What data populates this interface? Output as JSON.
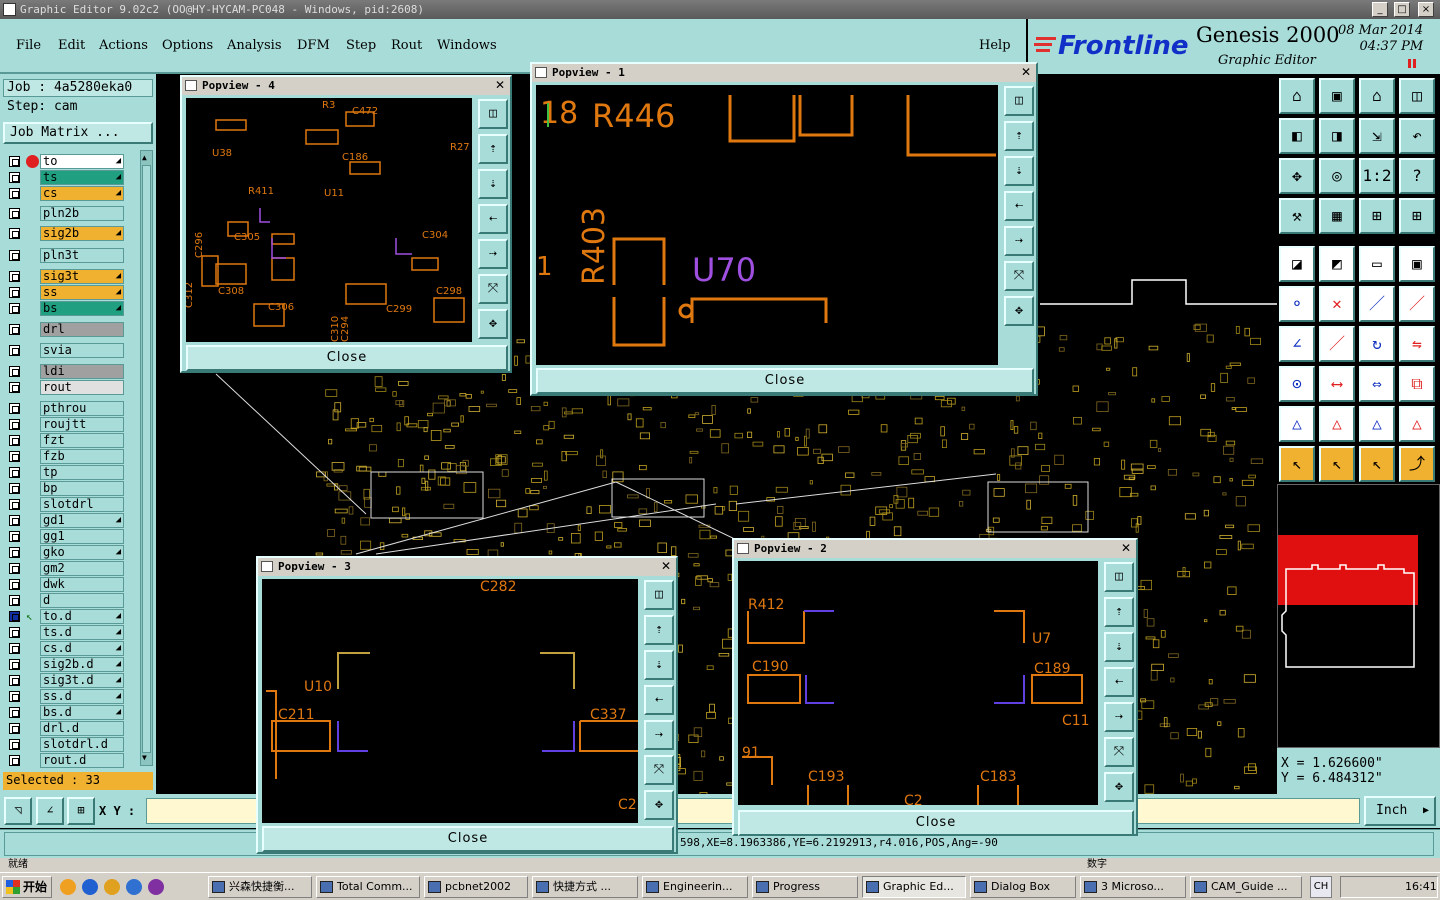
{
  "window": {
    "title": "Graphic Editor 9.02c2 (OO@HY-HYCAM-PC048 - Windows, pid:2608)"
  },
  "menu": [
    "File",
    "Edit",
    "Actions",
    "Options",
    "Analysis",
    "DFM",
    "Step",
    "Rout",
    "Windows"
  ],
  "help": "Help",
  "brand": {
    "logo": "Frontline",
    "product": "Genesis 2000",
    "subtitle": "Graphic Editor",
    "date": "08 Mar 2014",
    "time": "04:37 PM"
  },
  "job": {
    "job_label": "Job : 4a5280eka0",
    "step_label": "Step: cam",
    "matrix_button": "Job Matrix ..."
  },
  "layers": [
    {
      "name": "to",
      "color": "#ffffff",
      "dot": "#e02020"
    },
    {
      "name": "ts",
      "color": "#20a080"
    },
    {
      "name": "cs",
      "color": "#f0b030"
    },
    {
      "name": "pln2b",
      "color": "#a8dcd8"
    },
    {
      "name": "sig2b",
      "color": "#f0b030"
    },
    {
      "name": "pln3t",
      "color": "#a8dcd8"
    },
    {
      "name": "sig3t",
      "color": "#f0b030"
    },
    {
      "name": "ss",
      "color": "#f0b030"
    },
    {
      "name": "bs",
      "color": "#20a080"
    },
    {
      "name": "drl",
      "color": "#a0a0a0"
    },
    {
      "name": "svia",
      "color": "#a8dcd8"
    },
    {
      "name": "ldi",
      "color": "#a0a0a0"
    },
    {
      "name": "rout",
      "color": "#e0e0e0"
    },
    {
      "name": "pthrou",
      "color": "#a8dcd8"
    },
    {
      "name": "roujtt",
      "color": "#a8dcd8"
    },
    {
      "name": "fzt",
      "color": "#a8dcd8"
    },
    {
      "name": "fzb",
      "color": "#a8dcd8"
    },
    {
      "name": "tp",
      "color": "#a8dcd8"
    },
    {
      "name": "bp",
      "color": "#a8dcd8"
    },
    {
      "name": "slotdrl",
      "color": "#a8dcd8"
    },
    {
      "name": "gd1",
      "color": "#a8dcd8"
    },
    {
      "name": "gg1",
      "color": "#a8dcd8"
    },
    {
      "name": "gko",
      "color": "#a8dcd8"
    },
    {
      "name": "gm2",
      "color": "#a8dcd8"
    },
    {
      "name": "dwk",
      "color": "#a8dcd8"
    },
    {
      "name": "d",
      "color": "#a8dcd8"
    },
    {
      "name": "to.d",
      "color": "#a8dcd8"
    },
    {
      "name": "ts.d",
      "color": "#a8dcd8"
    },
    {
      "name": "cs.d",
      "color": "#a8dcd8"
    },
    {
      "name": "sig2b.d",
      "color": "#a8dcd8"
    },
    {
      "name": "sig3t.d",
      "color": "#a8dcd8"
    },
    {
      "name": "ss.d",
      "color": "#a8dcd8"
    },
    {
      "name": "bs.d",
      "color": "#a8dcd8"
    },
    {
      "name": "drl.d",
      "color": "#a8dcd8"
    },
    {
      "name": "slotdrl.d",
      "color": "#a8dcd8"
    },
    {
      "name": "rout.d",
      "color": "#a8dcd8"
    }
  ],
  "selected": "Selected : 33",
  "xy_label": "X Y :",
  "units": "Inch",
  "status_line": "598,XE=8.1963386,YE=6.2192913,r4.016,POS,Ang=-90",
  "status_left": "就绪",
  "status_right": "数字",
  "coords": {
    "x": "X  =  1.626600\"",
    "y": "Y  =  6.484312\""
  },
  "popviews": [
    {
      "title": "Popview - 4",
      "close": "Close",
      "labels": [
        "R3",
        "C472",
        "U38",
        "C186",
        "R27",
        "R411",
        "U11",
        "C305",
        "C304",
        "C296",
        "C312",
        "C308",
        "C306",
        "C310",
        "C294",
        "C299",
        "C298"
      ]
    },
    {
      "title": "Popview - 1",
      "close": "Close",
      "labels": [
        "18",
        "R446",
        "R403",
        "U70",
        "1"
      ]
    },
    {
      "title": "Popview - 3",
      "close": "Close",
      "labels": [
        "C282",
        "U10",
        "C211",
        "C337",
        "C2"
      ]
    },
    {
      "title": "Popview - 2",
      "close": "Close",
      "labels": [
        "R412",
        "U7",
        "C190",
        "C189",
        "C11",
        "91",
        "C193",
        "C183",
        "C2"
      ]
    }
  ],
  "taskbar": {
    "start": "开始",
    "items": [
      "兴森快捷衡...",
      "Total Comm...",
      "pcbnet2002",
      "快捷方式 ...",
      "Engineerin...",
      "Progress",
      "Graphic Ed...",
      "Dialog Box",
      "3 Microso...",
      "CAM_Guide ..."
    ],
    "lang": "CH",
    "clock": "16:41"
  },
  "tool_icons": [
    "home-icon",
    "save-icon",
    "house-icon",
    "window-icon",
    "zoom-in-icon",
    "zoom-out-icon",
    "zoom-fit-icon",
    "undo-icon",
    "pan-icon",
    "center-icon",
    "ratio-icon",
    "help-icon",
    "ruler-icon",
    "grid-icon",
    "snap-icon",
    "snap2-icon",
    "pad-icon",
    "draw-icon",
    "measure-icon",
    "select-icon",
    "connect-icon",
    "cross-icon",
    "line-icon",
    "arrow-icon",
    "angle-icon",
    "slash-icon",
    "rotate-icon",
    "mirror-icon",
    "move-icon",
    "dash-icon",
    "stretch-icon",
    "copy-icon",
    "tri-icon",
    "tri2-icon",
    "tri3-icon",
    "tri4-icon",
    "pointer-icon",
    "pointer2-icon",
    "pointer3-icon",
    "route-icon"
  ]
}
